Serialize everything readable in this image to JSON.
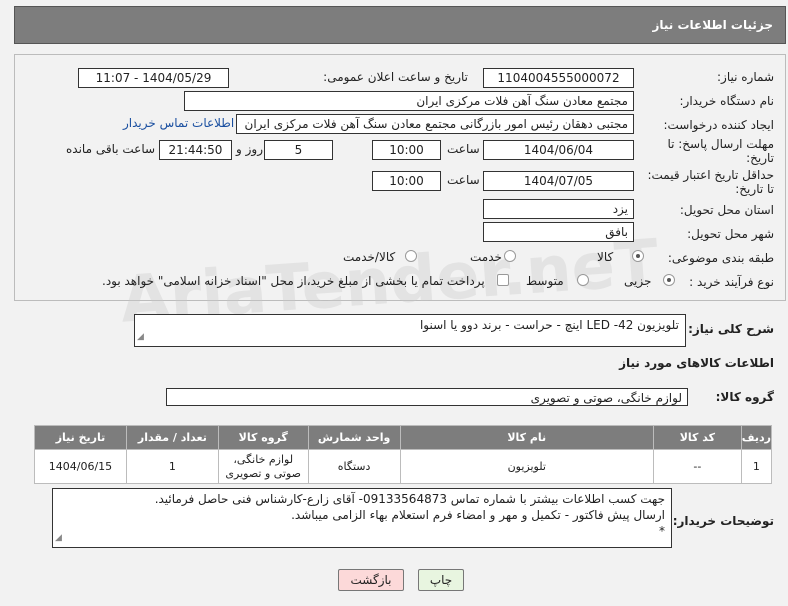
{
  "header": {
    "title": "جزئیات اطلاعات نیاز"
  },
  "form": {
    "need_number_label": "شماره نیاز:",
    "need_number": "1104004555000072",
    "announce_label": "تاریخ و ساعت اعلان عمومی:",
    "announce_value": "1404/05/29 - 11:07",
    "buyer_org_label": "نام دستگاه خریدار:",
    "buyer_org": "مجتمع معادن سنگ آهن فلات مرکزی ایران",
    "creator_label": "ایجاد کننده درخواست:",
    "creator": "مجتبی  دهقان رئیس امور بازرگانی مجتمع معادن سنگ آهن فلات مرکزی ایران",
    "contact_link": "اطلاعات تماس خریدار",
    "reply_deadline_label_1": "مهلت ارسال پاسخ: تا",
    "reply_deadline_label_2": "تاریخ:",
    "reply_date": "1404/06/04",
    "time_label": "ساعت",
    "reply_time": "10:00",
    "days_value": "5",
    "days_label": "روز و",
    "remaining_time": "21:44:50",
    "remaining_label": "ساعت باقی مانده",
    "price_valid_label_1": "حداقل تاریخ اعتبار قیمت:",
    "price_valid_label_2": "تا تاریخ:",
    "price_date": "1404/07/05",
    "price_time": "10:00",
    "province_label": "استان محل تحویل:",
    "province": "یزد",
    "city_label": "شهر محل تحویل:",
    "city": "بافق",
    "category_label": "طبقه بندی موضوعی:",
    "category_options": [
      "کالا",
      "خدمت",
      "کالا/خدمت"
    ],
    "process_label": "نوع فرآیند خرید :",
    "process_options": [
      "جزیی",
      "متوسط"
    ],
    "payment_note": "پرداخت تمام یا بخشی از مبلغ خرید،از محل \"اسناد خزانه اسلامی\" خواهد بود."
  },
  "summary": {
    "label": "شرح کلی نیاز:",
    "text": "تلویزیون LED -42 اینچ - حراست - برند دوو یا اسنوا"
  },
  "goods": {
    "section_title": "اطلاعات کالاهای مورد نیاز",
    "group_label": "گروه کالا:",
    "group_value": "لوازم خانگی، صوتی و تصویری",
    "columns": [
      "ردیف",
      "کد کالا",
      "نام کالا",
      "واحد شمارش",
      "گروه کالا",
      "تعداد / مقدار",
      "تاریخ نیاز"
    ],
    "rows": [
      [
        "1",
        "--",
        "تلویزیون",
        "دستگاه",
        "لوازم خانگی، صوتی و تصویری",
        "1",
        "1404/06/15"
      ]
    ]
  },
  "buyer_notes": {
    "label": "توضیحات خریدار:",
    "line1": "جهت کسب اطلاعات بیشتر با شماره تماس 09133564873- آقای زارع-کارشناس فنی حاصل فرمائید.",
    "line2": "ارسال پیش فاکتور - تکمیل و مهر و امضاء فرم استعلام بهاء الزامی میباشد.",
    "line3": "*"
  },
  "buttons": {
    "print": "چاپ",
    "back": "بازگشت"
  },
  "watermark": "AriaTender.neT",
  "colors": {
    "header_bg": "#7d7d7d",
    "link": "#1a4fa0",
    "back_btn": "#fcd9d9",
    "print_btn": "#e8f5e0"
  }
}
